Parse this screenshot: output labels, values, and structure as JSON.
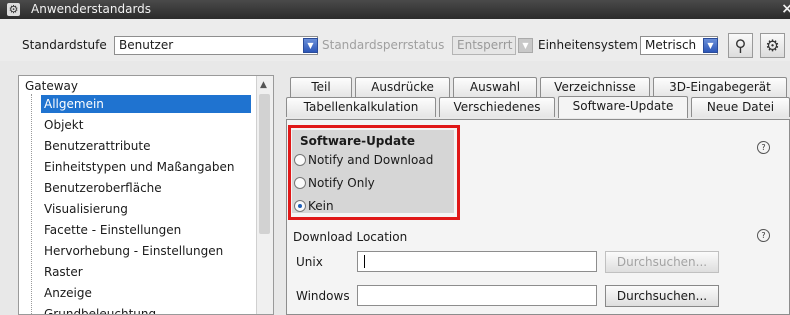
{
  "window": {
    "title": "Anwenderstandards"
  },
  "toolbar": {
    "standard_level_label": "Standardstufe",
    "standard_level_value": "Benutzer",
    "lock_status_label": "Standardsperrstatus",
    "lock_status_value": "Entsperrt",
    "units_label": "Einheitensystem",
    "units_value": "Metrisch"
  },
  "tree": {
    "root": "Gateway",
    "items": [
      {
        "label": "Allgemein",
        "selected": true
      },
      {
        "label": "Objekt"
      },
      {
        "label": "Benutzerattribute"
      },
      {
        "label": "Einheitstypen und Maßangaben"
      },
      {
        "label": "Benutzeroberfläche"
      },
      {
        "label": "Visualisierung"
      },
      {
        "label": "Facette - Einstellungen"
      },
      {
        "label": "Hervorhebung - Einstellungen"
      },
      {
        "label": "Raster"
      },
      {
        "label": "Anzeige"
      },
      {
        "label": "Grundbeleuchtung"
      }
    ]
  },
  "tabs": {
    "row1": [
      "Teil",
      "Ausdrücke",
      "Auswahl",
      "Verzeichnisse",
      "3D-Eingabegerät"
    ],
    "row2": [
      "Tabellenkalkulation",
      "Verschiedenes",
      "Software-Update",
      "Neue Datei"
    ],
    "active": "Software-Update"
  },
  "software_update": {
    "group_title": "Software-Update",
    "options": [
      "Notify and Download",
      "Notify Only",
      "Kein"
    ],
    "selected": "Kein"
  },
  "download": {
    "title": "Download Location",
    "unix_label": "Unix",
    "unix_value": "",
    "windows_label": "Windows",
    "windows_value": "",
    "browse_label": "Durchsuchen..."
  },
  "colors": {
    "highlight": "#e01818",
    "selection": "#1f73d0"
  }
}
